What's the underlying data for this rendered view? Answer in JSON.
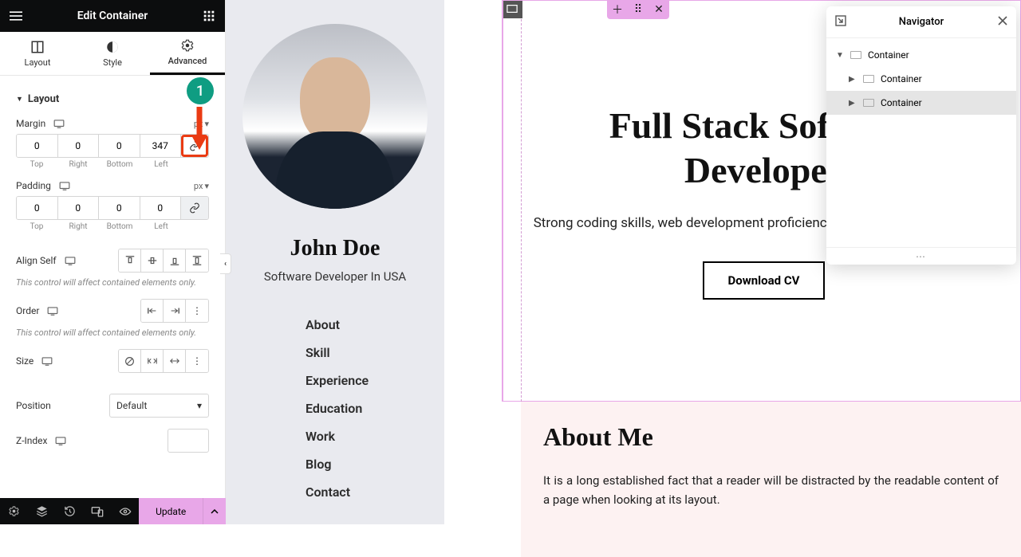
{
  "editor": {
    "header_title": "Edit Container",
    "tabs": {
      "layout": "Layout",
      "style": "Style",
      "advanced": "Advanced"
    },
    "section_layout": "Layout",
    "margin_label": "Margin",
    "margin_unit": "px",
    "margin": {
      "top": "0",
      "right": "0",
      "bottom": "0",
      "left": "347"
    },
    "padding_label": "Padding",
    "padding_unit": "px",
    "padding": {
      "top": "0",
      "right": "0",
      "bottom": "0",
      "left": "0"
    },
    "dim_sides": {
      "top": "Top",
      "right": "Right",
      "bottom": "Bottom",
      "left": "Left"
    },
    "align_self_label": "Align Self",
    "order_label": "Order",
    "size_label": "Size",
    "position_label": "Position",
    "position_value": "Default",
    "zindex_label": "Z-Index",
    "zindex_value": "",
    "note_contained": "This control will affect contained elements only.",
    "footer": {
      "update": "Update"
    }
  },
  "annotation": {
    "badge": "1"
  },
  "profile": {
    "name": "John Doe",
    "role": "Software Developer In USA",
    "nav": [
      "About",
      "Skill",
      "Experience",
      "Education",
      "Work",
      "Blog",
      "Contact"
    ]
  },
  "hero": {
    "title": "Full Stack Software Developer",
    "subtitle": "Strong coding skills, web development proficiency, problem-solving expertise",
    "cta": "Download CV"
  },
  "about": {
    "heading": "About Me",
    "body": "It is a long established fact that a reader will be distracted by the readable content of a page when looking at its layout."
  },
  "navigator": {
    "title": "Navigator",
    "items": [
      {
        "label": "Container",
        "depth": 0,
        "expanded": true,
        "selected": false
      },
      {
        "label": "Container",
        "depth": 1,
        "expanded": false,
        "selected": false
      },
      {
        "label": "Container",
        "depth": 1,
        "expanded": false,
        "selected": true
      }
    ]
  }
}
